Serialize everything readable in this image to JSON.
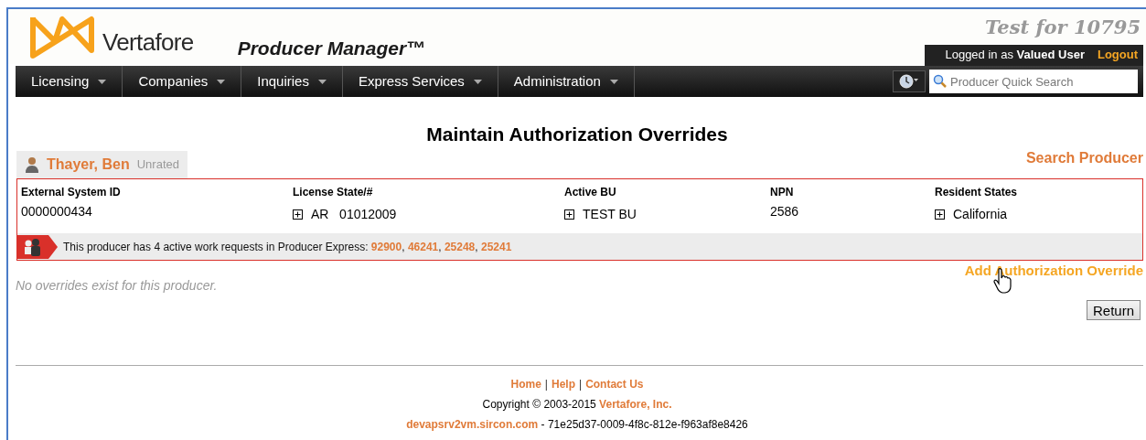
{
  "header": {
    "brand": "Vertafore",
    "product": "Producer Manager™",
    "environment": "Test for 10795",
    "login_prefix": "Logged in as",
    "user": "Valued User",
    "logout": "Logout"
  },
  "nav": [
    {
      "label": "Licensing"
    },
    {
      "label": "Companies"
    },
    {
      "label": "Inquiries"
    },
    {
      "label": "Express Services"
    },
    {
      "label": "Administration"
    }
  ],
  "quick_search": {
    "placeholder": "Producer Quick Search"
  },
  "page_title": "Maintain Authorization Overrides",
  "producer": {
    "name": "Thayer, Ben",
    "rating": "Unrated"
  },
  "search_producer": "Search Producer",
  "details": [
    {
      "heading": "External System ID",
      "value": "0000000434",
      "expandable": false
    },
    {
      "heading": "License State/#",
      "value": "AR   01012009",
      "expandable": true
    },
    {
      "heading": "Active BU",
      "value": "TEST BU",
      "expandable": true
    },
    {
      "heading": "NPN",
      "value": "2586",
      "expandable": false
    },
    {
      "heading": "Resident States",
      "value": "California",
      "expandable": true
    }
  ],
  "work_requests": {
    "message": "This producer has 4 active work requests in Producer Express: ",
    "links": [
      "92900",
      "46241",
      "25248",
      "25241"
    ],
    "link_separator": ", "
  },
  "empty_message": "No overrides exist for this producer.",
  "add_link": "Add Authorization Override",
  "return_button": "Return",
  "footer": {
    "links": [
      "Home",
      "Help",
      "Contact Us"
    ],
    "separator": "|",
    "copyright": "Copyright © 2003-2015 ",
    "company": "Vertafore, Inc.",
    "server": "devapsrv2vm.sircon.com",
    "session": " - 71e25d37-0009-4f8c-812e-f963af8e8426"
  }
}
